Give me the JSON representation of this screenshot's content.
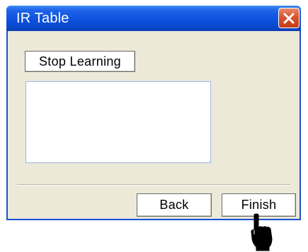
{
  "window": {
    "title": "IR Table",
    "close_icon": "close-icon"
  },
  "content": {
    "stop_learning_label": "Stop Learning",
    "list_items": []
  },
  "footer": {
    "back_label": "Back",
    "finish_label": "Finish"
  },
  "cursor": {
    "icon": "hand-pointer-icon"
  },
  "colors": {
    "titlebar": "#0c52de",
    "window_bg": "#ece9d8",
    "close_button": "#d9532e",
    "list_border": "#9fb4e6"
  }
}
